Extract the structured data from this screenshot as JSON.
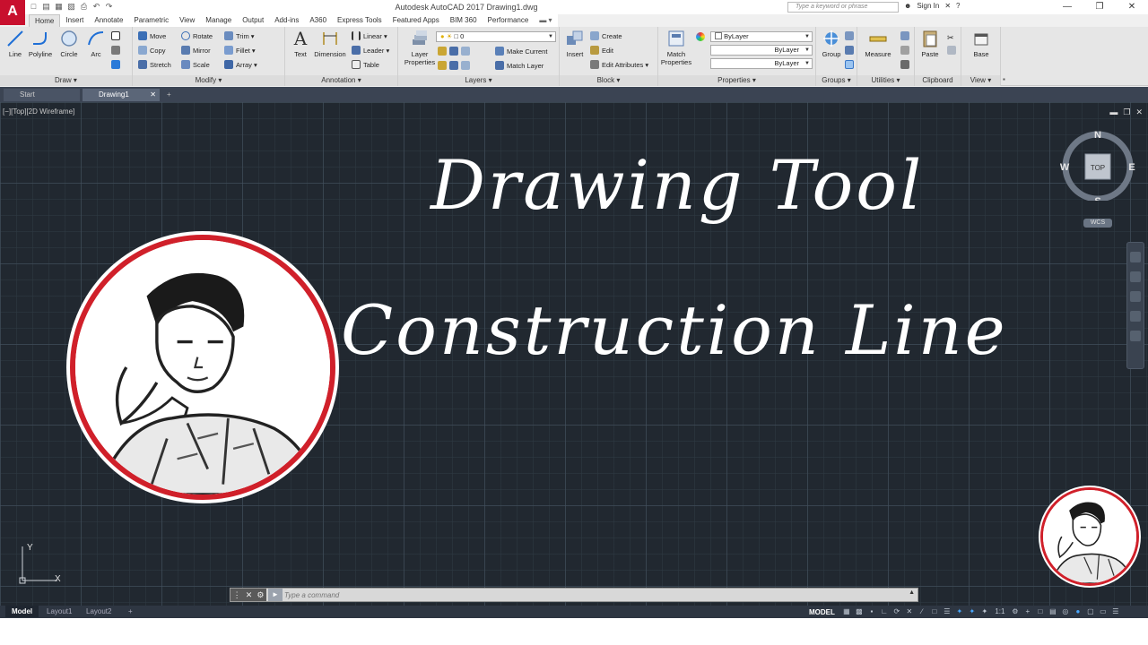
{
  "app": {
    "logo_letter": "A",
    "title": "Autodesk AutoCAD 2017    Drawing1.dwg",
    "search_placeholder": "Type a keyword or phrase",
    "sign_in": "Sign In"
  },
  "ribbon_tabs": [
    "Home",
    "Insert",
    "Annotate",
    "Parametric",
    "View",
    "Manage",
    "Output",
    "Add-ins",
    "A360",
    "Express Tools",
    "Featured Apps",
    "BIM 360",
    "Performance"
  ],
  "panels": {
    "draw": {
      "title": "Draw",
      "line": "Line",
      "polyline": "Polyline",
      "circle": "Circle",
      "arc": "Arc"
    },
    "modify": {
      "title": "Modify",
      "move": "Move",
      "rotate": "Rotate",
      "trim": "Trim",
      "copy": "Copy",
      "mirror": "Mirror",
      "fillet": "Fillet",
      "stretch": "Stretch",
      "scale": "Scale",
      "array": "Array"
    },
    "annotation": {
      "title": "Annotation",
      "text": "Text",
      "dimension": "Dimension",
      "linear": "Linear",
      "leader": "Leader",
      "table": "Table"
    },
    "layers": {
      "title": "Layers",
      "layer_properties_1": "Layer",
      "layer_properties_2": "Properties",
      "layer_value": "0",
      "make_current": "Make Current",
      "match_layer": "Match Layer"
    },
    "block": {
      "title": "Block",
      "insert": "Insert",
      "create": "Create",
      "edit": "Edit",
      "edit_attributes": "Edit Attributes"
    },
    "properties": {
      "title": "Properties",
      "match_1": "Match",
      "match_2": "Properties",
      "color": "ByLayer",
      "linetype": "ByLayer",
      "lineweight": "ByLayer"
    },
    "groups": {
      "title": "Groups",
      "group": "Group"
    },
    "utilities": {
      "title": "Utilities",
      "measure": "Measure"
    },
    "clipboard": {
      "title": "Clipboard",
      "paste": "Paste"
    },
    "view": {
      "title": "View",
      "base": "Base"
    }
  },
  "file_tabs": {
    "start": "Start",
    "drawing": "Drawing1"
  },
  "viewport": {
    "label": "[−][Top][2D Wireframe]",
    "heading_line1": "Drawing Tool",
    "heading_line2": "Construction Line"
  },
  "viewcube": {
    "n": "N",
    "s": "S",
    "e": "E",
    "w": "W",
    "top": "TOP",
    "wcs": "WCS"
  },
  "ucs": {
    "x": "X",
    "y": "Y"
  },
  "command": {
    "placeholder": "Type a command"
  },
  "layout_tabs": {
    "model": "Model",
    "layout1": "Layout1",
    "layout2": "Layout2"
  },
  "status": {
    "model": "MODEL",
    "scale": "1:1"
  },
  "colors": {
    "accent_red": "#c8102e",
    "canvas_bg": "#212830",
    "ring_red": "#d0202a"
  }
}
